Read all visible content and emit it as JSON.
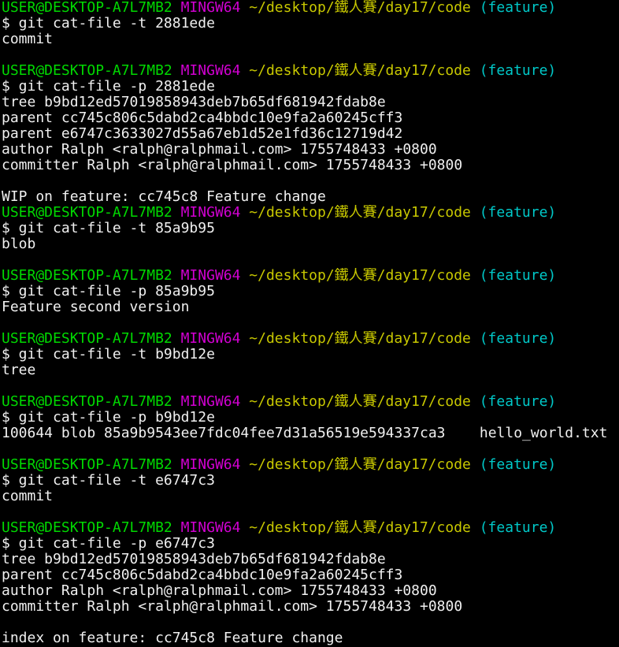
{
  "colors": {
    "user_host": "#00d900",
    "shell": "#d100d1",
    "path": "#c8c800",
    "branch": "#00c8c8",
    "text": "#f0f0f0",
    "background": "#000000"
  },
  "lines": [
    {
      "type": "prompt",
      "user_host": "USER@DESKTOP-A7L7MB2",
      "shell": "MINGW64",
      "path": "~/desktop/鐵人賽/day17/code",
      "branch": "(feature)"
    },
    {
      "type": "text",
      "text": "$ git cat-file -t 2881ede"
    },
    {
      "type": "text",
      "text": "commit"
    },
    {
      "type": "text",
      "text": ""
    },
    {
      "type": "prompt",
      "user_host": "USER@DESKTOP-A7L7MB2",
      "shell": "MINGW64",
      "path": "~/desktop/鐵人賽/day17/code",
      "branch": "(feature)"
    },
    {
      "type": "text",
      "text": "$ git cat-file -p 2881ede"
    },
    {
      "type": "text",
      "text": "tree b9bd12ed57019858943deb7b65df681942fdab8e"
    },
    {
      "type": "text",
      "text": "parent cc745c806c5dabd2ca4bbdc10e9fa2a60245cff3"
    },
    {
      "type": "text",
      "text": "parent e6747c3633027d55a67eb1d52e1fd36c12719d42"
    },
    {
      "type": "text",
      "text": "author Ralph <ralph@ralphmail.com> 1755748433 +0800"
    },
    {
      "type": "text",
      "text": "committer Ralph <ralph@ralphmail.com> 1755748433 +0800"
    },
    {
      "type": "text",
      "text": ""
    },
    {
      "type": "text",
      "text": "WIP on feature: cc745c8 Feature change"
    },
    {
      "type": "prompt",
      "user_host": "USER@DESKTOP-A7L7MB2",
      "shell": "MINGW64",
      "path": "~/desktop/鐵人賽/day17/code",
      "branch": "(feature)"
    },
    {
      "type": "text",
      "text": "$ git cat-file -t 85a9b95"
    },
    {
      "type": "text",
      "text": "blob"
    },
    {
      "type": "text",
      "text": ""
    },
    {
      "type": "prompt",
      "user_host": "USER@DESKTOP-A7L7MB2",
      "shell": "MINGW64",
      "path": "~/desktop/鐵人賽/day17/code",
      "branch": "(feature)"
    },
    {
      "type": "text",
      "text": "$ git cat-file -p 85a9b95"
    },
    {
      "type": "text",
      "text": "Feature second version"
    },
    {
      "type": "text",
      "text": ""
    },
    {
      "type": "prompt",
      "user_host": "USER@DESKTOP-A7L7MB2",
      "shell": "MINGW64",
      "path": "~/desktop/鐵人賽/day17/code",
      "branch": "(feature)"
    },
    {
      "type": "text",
      "text": "$ git cat-file -t b9bd12e"
    },
    {
      "type": "text",
      "text": "tree"
    },
    {
      "type": "text",
      "text": ""
    },
    {
      "type": "prompt",
      "user_host": "USER@DESKTOP-A7L7MB2",
      "shell": "MINGW64",
      "path": "~/desktop/鐵人賽/day17/code",
      "branch": "(feature)"
    },
    {
      "type": "text",
      "text": "$ git cat-file -p b9bd12e"
    },
    {
      "type": "text",
      "text": "100644 blob 85a9b9543ee7fdc04fee7d31a56519e594337ca3    hello_world.txt"
    },
    {
      "type": "text",
      "text": ""
    },
    {
      "type": "prompt",
      "user_host": "USER@DESKTOP-A7L7MB2",
      "shell": "MINGW64",
      "path": "~/desktop/鐵人賽/day17/code",
      "branch": "(feature)"
    },
    {
      "type": "text",
      "text": "$ git cat-file -t e6747c3"
    },
    {
      "type": "text",
      "text": "commit"
    },
    {
      "type": "text",
      "text": ""
    },
    {
      "type": "prompt",
      "user_host": "USER@DESKTOP-A7L7MB2",
      "shell": "MINGW64",
      "path": "~/desktop/鐵人賽/day17/code",
      "branch": "(feature)"
    },
    {
      "type": "text",
      "text": "$ git cat-file -p e6747c3"
    },
    {
      "type": "text",
      "text": "tree b9bd12ed57019858943deb7b65df681942fdab8e"
    },
    {
      "type": "text",
      "text": "parent cc745c806c5dabd2ca4bbdc10e9fa2a60245cff3"
    },
    {
      "type": "text",
      "text": "author Ralph <ralph@ralphmail.com> 1755748433 +0800"
    },
    {
      "type": "text",
      "text": "committer Ralph <ralph@ralphmail.com> 1755748433 +0800"
    },
    {
      "type": "text",
      "text": ""
    },
    {
      "type": "text",
      "text": "index on feature: cc745c8 Feature change"
    }
  ]
}
